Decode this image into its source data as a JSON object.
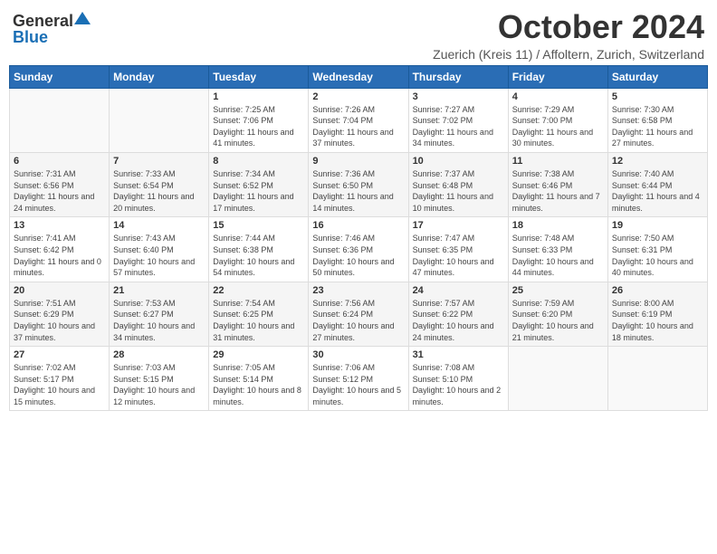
{
  "header": {
    "logo_general": "General",
    "logo_blue": "Blue",
    "month_title": "October 2024",
    "subtitle": "Zuerich (Kreis 11) / Affoltern, Zurich, Switzerland"
  },
  "weekdays": [
    "Sunday",
    "Monday",
    "Tuesday",
    "Wednesday",
    "Thursday",
    "Friday",
    "Saturday"
  ],
  "weeks": [
    [
      {
        "day": "",
        "info": ""
      },
      {
        "day": "",
        "info": ""
      },
      {
        "day": "1",
        "info": "Sunrise: 7:25 AM\nSunset: 7:06 PM\nDaylight: 11 hours and 41 minutes."
      },
      {
        "day": "2",
        "info": "Sunrise: 7:26 AM\nSunset: 7:04 PM\nDaylight: 11 hours and 37 minutes."
      },
      {
        "day": "3",
        "info": "Sunrise: 7:27 AM\nSunset: 7:02 PM\nDaylight: 11 hours and 34 minutes."
      },
      {
        "day": "4",
        "info": "Sunrise: 7:29 AM\nSunset: 7:00 PM\nDaylight: 11 hours and 30 minutes."
      },
      {
        "day": "5",
        "info": "Sunrise: 7:30 AM\nSunset: 6:58 PM\nDaylight: 11 hours and 27 minutes."
      }
    ],
    [
      {
        "day": "6",
        "info": "Sunrise: 7:31 AM\nSunset: 6:56 PM\nDaylight: 11 hours and 24 minutes."
      },
      {
        "day": "7",
        "info": "Sunrise: 7:33 AM\nSunset: 6:54 PM\nDaylight: 11 hours and 20 minutes."
      },
      {
        "day": "8",
        "info": "Sunrise: 7:34 AM\nSunset: 6:52 PM\nDaylight: 11 hours and 17 minutes."
      },
      {
        "day": "9",
        "info": "Sunrise: 7:36 AM\nSunset: 6:50 PM\nDaylight: 11 hours and 14 minutes."
      },
      {
        "day": "10",
        "info": "Sunrise: 7:37 AM\nSunset: 6:48 PM\nDaylight: 11 hours and 10 minutes."
      },
      {
        "day": "11",
        "info": "Sunrise: 7:38 AM\nSunset: 6:46 PM\nDaylight: 11 hours and 7 minutes."
      },
      {
        "day": "12",
        "info": "Sunrise: 7:40 AM\nSunset: 6:44 PM\nDaylight: 11 hours and 4 minutes."
      }
    ],
    [
      {
        "day": "13",
        "info": "Sunrise: 7:41 AM\nSunset: 6:42 PM\nDaylight: 11 hours and 0 minutes."
      },
      {
        "day": "14",
        "info": "Sunrise: 7:43 AM\nSunset: 6:40 PM\nDaylight: 10 hours and 57 minutes."
      },
      {
        "day": "15",
        "info": "Sunrise: 7:44 AM\nSunset: 6:38 PM\nDaylight: 10 hours and 54 minutes."
      },
      {
        "day": "16",
        "info": "Sunrise: 7:46 AM\nSunset: 6:36 PM\nDaylight: 10 hours and 50 minutes."
      },
      {
        "day": "17",
        "info": "Sunrise: 7:47 AM\nSunset: 6:35 PM\nDaylight: 10 hours and 47 minutes."
      },
      {
        "day": "18",
        "info": "Sunrise: 7:48 AM\nSunset: 6:33 PM\nDaylight: 10 hours and 44 minutes."
      },
      {
        "day": "19",
        "info": "Sunrise: 7:50 AM\nSunset: 6:31 PM\nDaylight: 10 hours and 40 minutes."
      }
    ],
    [
      {
        "day": "20",
        "info": "Sunrise: 7:51 AM\nSunset: 6:29 PM\nDaylight: 10 hours and 37 minutes."
      },
      {
        "day": "21",
        "info": "Sunrise: 7:53 AM\nSunset: 6:27 PM\nDaylight: 10 hours and 34 minutes."
      },
      {
        "day": "22",
        "info": "Sunrise: 7:54 AM\nSunset: 6:25 PM\nDaylight: 10 hours and 31 minutes."
      },
      {
        "day": "23",
        "info": "Sunrise: 7:56 AM\nSunset: 6:24 PM\nDaylight: 10 hours and 27 minutes."
      },
      {
        "day": "24",
        "info": "Sunrise: 7:57 AM\nSunset: 6:22 PM\nDaylight: 10 hours and 24 minutes."
      },
      {
        "day": "25",
        "info": "Sunrise: 7:59 AM\nSunset: 6:20 PM\nDaylight: 10 hours and 21 minutes."
      },
      {
        "day": "26",
        "info": "Sunrise: 8:00 AM\nSunset: 6:19 PM\nDaylight: 10 hours and 18 minutes."
      }
    ],
    [
      {
        "day": "27",
        "info": "Sunrise: 7:02 AM\nSunset: 5:17 PM\nDaylight: 10 hours and 15 minutes."
      },
      {
        "day": "28",
        "info": "Sunrise: 7:03 AM\nSunset: 5:15 PM\nDaylight: 10 hours and 12 minutes."
      },
      {
        "day": "29",
        "info": "Sunrise: 7:05 AM\nSunset: 5:14 PM\nDaylight: 10 hours and 8 minutes."
      },
      {
        "day": "30",
        "info": "Sunrise: 7:06 AM\nSunset: 5:12 PM\nDaylight: 10 hours and 5 minutes."
      },
      {
        "day": "31",
        "info": "Sunrise: 7:08 AM\nSunset: 5:10 PM\nDaylight: 10 hours and 2 minutes."
      },
      {
        "day": "",
        "info": ""
      },
      {
        "day": "",
        "info": ""
      }
    ]
  ]
}
